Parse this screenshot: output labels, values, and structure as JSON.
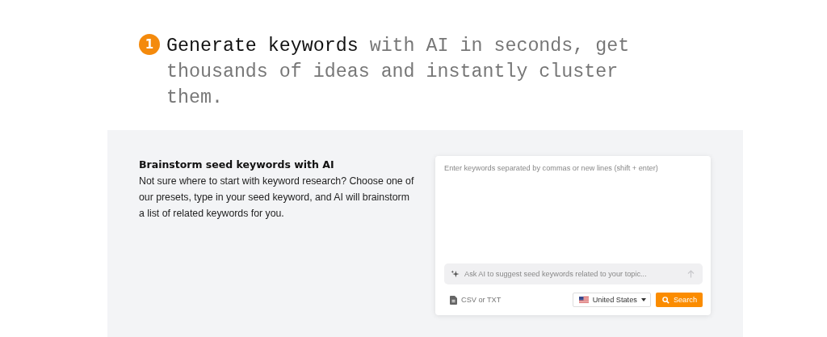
{
  "step": {
    "number": "1",
    "heading": "**Generate keywords** with AI in seconds, get thousands of ideas and instantly cluster them."
  },
  "panel": {
    "title": "Brainstorm seed keywords with AI",
    "description": "Not sure where to start with keyword research? Choose one of our presets, type in your seed keyword, and AI will brainstorm a list of related keywords for you.",
    "keywords_input": {
      "placeholder": "Enter keywords separated by commas or new lines (shift + enter)"
    },
    "ai_prompt": {
      "placeholder": "Ask AI to suggest seed keywords related to your topic..."
    },
    "upload": {
      "label": "CSV or TXT"
    },
    "country": {
      "label": "United States"
    },
    "search_button": {
      "label": "Search"
    }
  }
}
